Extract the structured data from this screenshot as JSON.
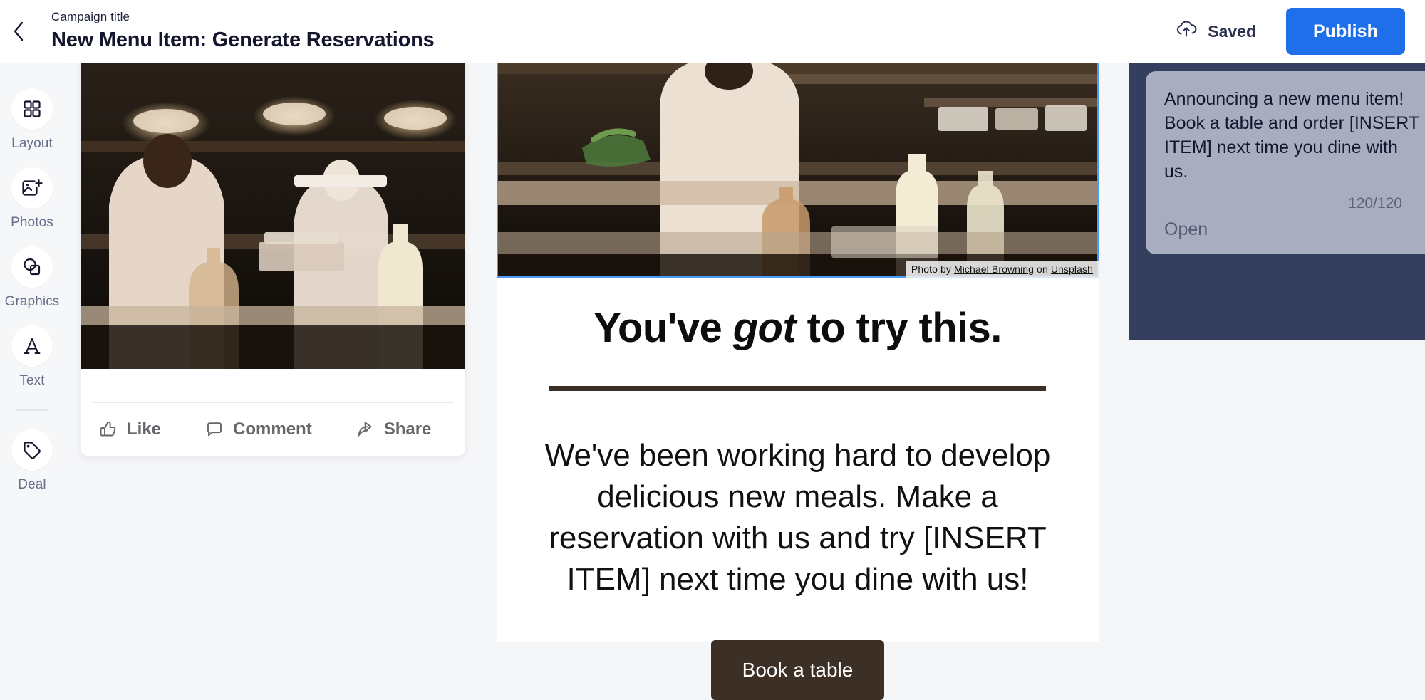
{
  "header": {
    "back_icon": "chevron-left-icon",
    "campaign_label": "Campaign title",
    "campaign_title": "New Menu Item: Generate Reservations",
    "saved_icon": "cloud-upload-icon",
    "saved_label": "Saved",
    "publish_label": "Publish",
    "publish_color": "#1f6fea"
  },
  "sidebar": {
    "items": [
      {
        "label": "Layout",
        "icon": "grid-icon"
      },
      {
        "label": "Photos",
        "icon": "image-add-icon"
      },
      {
        "label": "Graphics",
        "icon": "shapes-icon"
      },
      {
        "label": "Text",
        "icon": "letter-a-icon"
      },
      {
        "label": "Deal",
        "icon": "tag-icon"
      }
    ]
  },
  "facebook_preview": {
    "photo_alt": "restaurant kitchen with chefs",
    "actions": [
      {
        "label": "Like",
        "icon": "thumbs-up-icon"
      },
      {
        "label": "Comment",
        "icon": "speech-bubble-icon"
      },
      {
        "label": "Share",
        "icon": "share-arrow-icon"
      }
    ]
  },
  "canvas": {
    "photo_alt": "restaurant kitchen counter with squeeze bottles",
    "credit": {
      "prefix": "Photo by ",
      "photographer": "Michael Browning",
      "middle": " on ",
      "source": "Unsplash"
    },
    "headline_before": "You've ",
    "headline_emphasis": "got",
    "headline_after": " to try this.",
    "body": "We've been working hard to develop delicious new meals. Make a reservation with us and try [INSERT ITEM] next time you dine with us!",
    "cta_label": "Book a table",
    "accent_color": "#3c2f26",
    "selection_color": "#4a9bf5"
  },
  "right_panel": {
    "background_color": "#343f5f",
    "card_color": "#a8aec0",
    "caption": "Announcing a new menu item! Book a table and order [INSERT ITEM] next time you dine with us.",
    "char_count": "120/120",
    "open_label": "Open"
  }
}
